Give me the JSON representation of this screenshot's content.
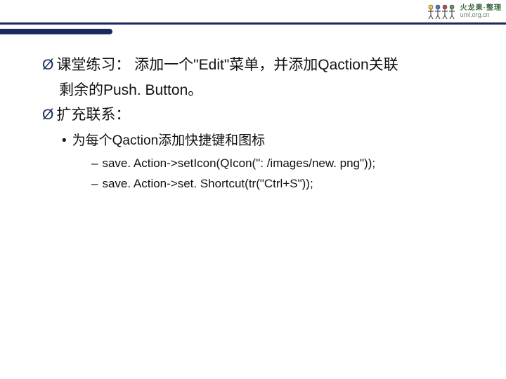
{
  "header": {
    "logo_title": "火龙果·整理",
    "logo_url": "uml.org.cn"
  },
  "content": {
    "bullets": [
      {
        "type": "main",
        "text": "课堂练习： 添加一个\"Edit\"菜单，并添加Qaction关联",
        "cont": "剩余的Push. Button。"
      },
      {
        "type": "main",
        "text": "扩充联系：",
        "sub": {
          "text": "为每个Qaction添加快捷键和图标",
          "code": [
            "save. Action->setIcon(QIcon(\": /images/new. png\"));",
            "save. Action->set. Shortcut(tr(\"Ctrl+S\"));"
          ]
        }
      }
    ]
  }
}
